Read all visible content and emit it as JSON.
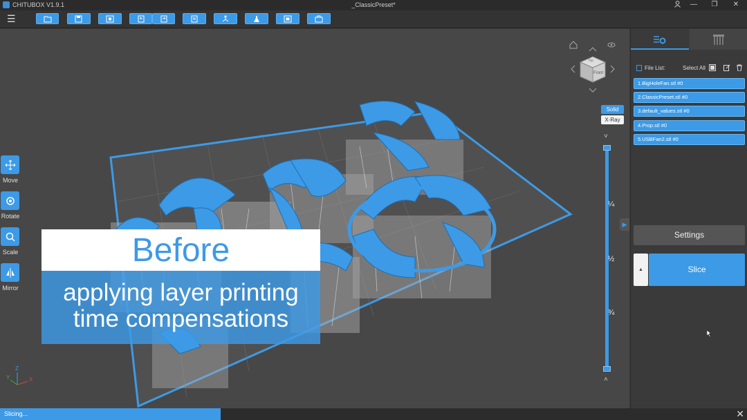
{
  "app": {
    "name": "CHITUBOX V1.9.1",
    "document_title": "_ClassicPreset*"
  },
  "window_buttons": {
    "minimize": "—",
    "maximize": "❐",
    "close": "✕"
  },
  "toolbar": {
    "menu_icon": "☰"
  },
  "left_tools": [
    {
      "label": "Move"
    },
    {
      "label": "Rotate"
    },
    {
      "label": "Scale"
    },
    {
      "label": "Mirror"
    }
  ],
  "overlay": {
    "title": "Before",
    "line1": "applying layer printing",
    "line2": "time compensations"
  },
  "view_modes": {
    "solid": "Solid",
    "xray": "X-Ray"
  },
  "layer_slider": {
    "marks": [
      "¼",
      "½",
      "¾"
    ],
    "up": "˄",
    "down": "˅"
  },
  "nav_cube": {
    "front_label": "Front",
    "top_label": "Top"
  },
  "axes": {
    "x": "X",
    "y": "Y",
    "z": "Z"
  },
  "panel": {
    "file_list_label": "File List:",
    "select_all_label": "Select All",
    "files": [
      "1.BigHoleFan.stl #0",
      "2.ClassicPreset.stl #0",
      "3.default_values.stl #0",
      "4.Prop.stl #0",
      "5.USBFan2.stl #0"
    ],
    "settings_label": "Settings",
    "slice_label": "Slice",
    "slice_side_label": "▲"
  },
  "status": {
    "text": "Slicing...",
    "progress": 0.295
  },
  "colors": {
    "accent": "#3d9ae6",
    "background": "#474747",
    "panel": "#3a3a3a"
  }
}
